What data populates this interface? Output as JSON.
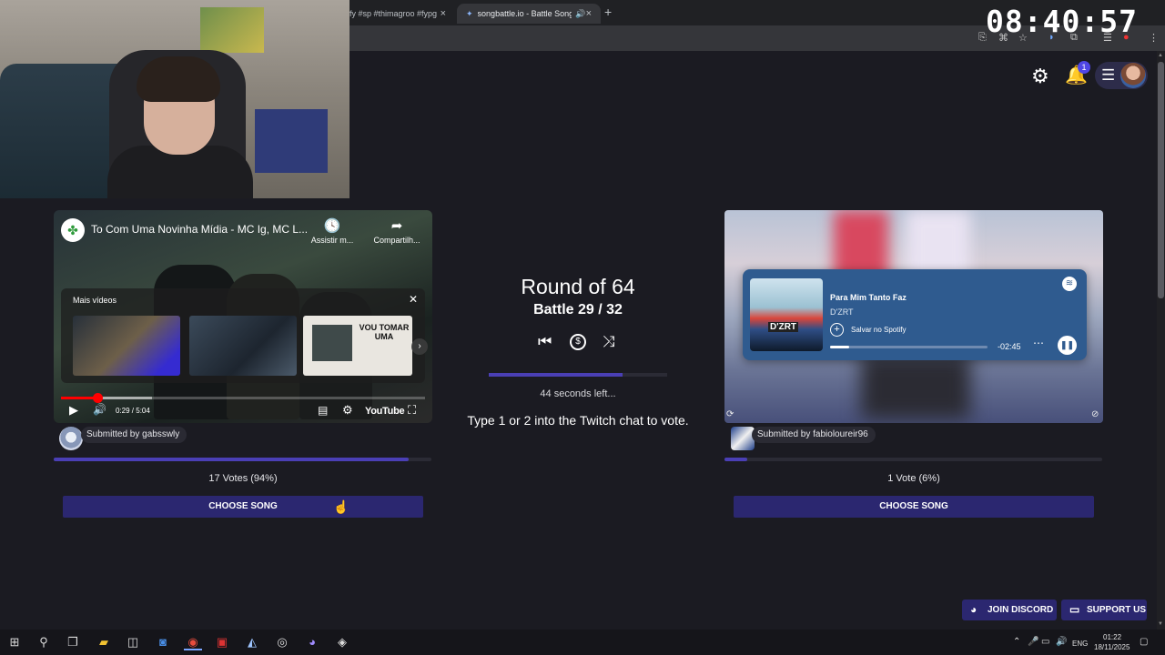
{
  "browser": {
    "tabs": [
      {
        "label": "fy #sp #thimagroo #fypg",
        "active": false
      },
      {
        "label": "songbattle.io - Battle Songs",
        "active": true
      }
    ],
    "new_tab": "+"
  },
  "overlay": {
    "clock": "08:40:57"
  },
  "header": {
    "notification_count": "1"
  },
  "left_song": {
    "player": {
      "title": "To Com Uma Novinha Mídia - MC Ig, MC L...",
      "watch_later": "Assistir m...",
      "share": "Compartilh...",
      "more_videos": "Mais vídeos",
      "thumb_text": "VOU TOMAR UMA",
      "time": "0:29 / 5:04",
      "brand": "YouTube",
      "progress": 0.1,
      "buffered": 0.25
    },
    "submitted_by": "Submitted by gabsswly",
    "votes": "17 Votes (94%)",
    "vote_share": 0.94,
    "choose": "CHOOSE SONG"
  },
  "center": {
    "round": "Round of 64",
    "battle": "Battle 29 / 32",
    "timer_fraction": 0.75,
    "time_left": "44 seconds left...",
    "instructions": "Type 1 or 2 into the Twitch chat to vote."
  },
  "right_song": {
    "spotify": {
      "song": "Para Mim Tanto Faz",
      "artist": "D'ZRT",
      "save": "Salvar no Spotify",
      "remaining": "-02:45",
      "album_logo": "D'ZRT",
      "progress": 0.12
    },
    "submitted_by": "Submitted by fabioloureir96",
    "votes": "1 Vote (6%)",
    "vote_share": 0.06,
    "choose": "CHOOSE SONG"
  },
  "footer": {
    "discord": "JOIN DISCORD",
    "support": "SUPPORT US"
  },
  "taskbar": {
    "lang": "ENG",
    "time": "01:22",
    "date": "18/11/2025"
  },
  "colors": {
    "accent": "#4a3fb5",
    "button": "#2b2770",
    "background": "#1b1b22",
    "spotify_card": "#2f5b8f"
  }
}
